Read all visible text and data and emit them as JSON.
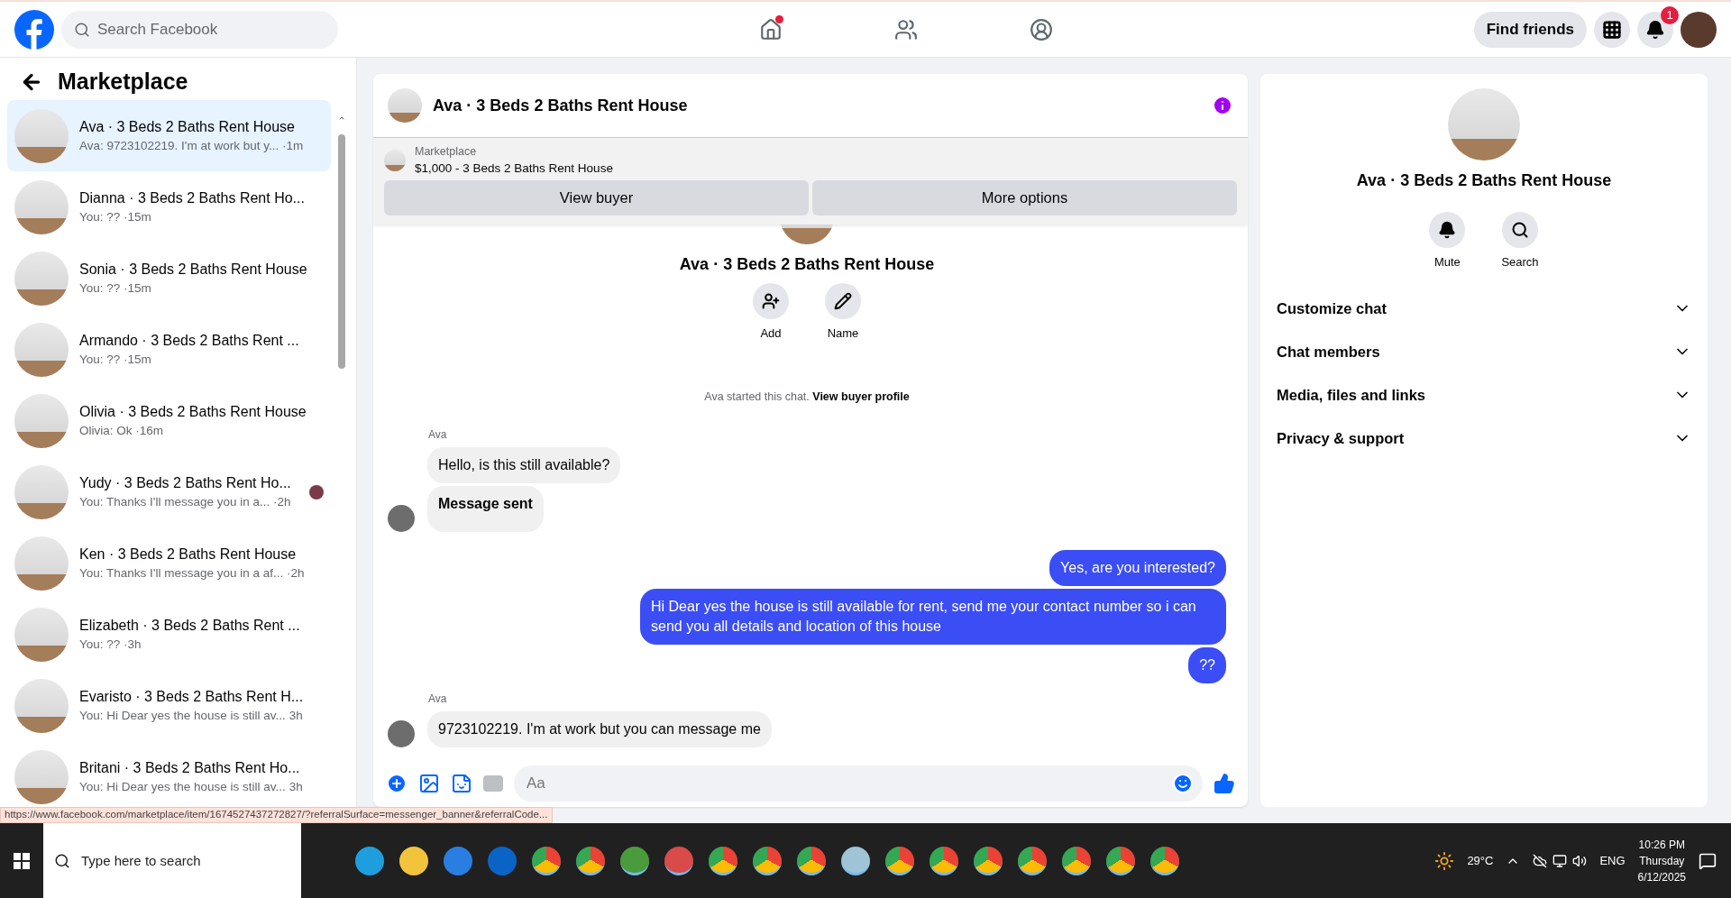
{
  "topbar": {
    "search": {
      "placeholder": "Search Facebook"
    },
    "nav": [
      {
        "selected": false,
        "dot": true
      },
      {
        "selected": false,
        "dot": false
      },
      {
        "selected": false,
        "dot": false
      }
    ],
    "find_friends": "Find friends",
    "notification_count": "1"
  },
  "sidebar": {
    "title": "Marketplace",
    "conversations": [
      {
        "name": "Ava · 3 Beds 2 Baths Rent House",
        "preview": "Ava: 9723102219. I'm at work but y...",
        "time": "·1m",
        "selected": true,
        "seen": false
      },
      {
        "name": "Dianna · 3 Beds 2 Baths Rent Ho...",
        "preview": "You: ??",
        "time": "·15m",
        "selected": false,
        "seen": false
      },
      {
        "name": "Sonia · 3 Beds 2 Baths Rent House",
        "preview": "You: ??",
        "time": "·15m",
        "selected": false,
        "seen": false
      },
      {
        "name": "Armando · 3 Beds 2 Baths Rent ...",
        "preview": "You: ??",
        "time": "·15m",
        "selected": false,
        "seen": false
      },
      {
        "name": "Olivia · 3 Beds 2 Baths Rent House",
        "preview": "Olivia: Ok",
        "time": "·16m",
        "selected": false,
        "seen": false
      },
      {
        "name": "Yudy · 3 Beds 2 Baths Rent Ho...",
        "preview": "You: Thanks I'll message you in a...",
        "time": "·2h",
        "selected": false,
        "seen": true
      },
      {
        "name": "Ken · 3 Beds 2 Baths Rent House",
        "preview": "You: Thanks I'll message you in a af...",
        "time": "·2h",
        "selected": false,
        "seen": false
      },
      {
        "name": "Elizabeth · 3 Beds 2 Baths Rent ...",
        "preview": "You: ??",
        "time": "·3h",
        "selected": false,
        "seen": false
      },
      {
        "name": "Evaristo · 3 Beds 2 Baths Rent H...",
        "preview": "You: Hi Dear yes the house is still av...",
        "time": "3h",
        "selected": false,
        "seen": false
      },
      {
        "name": "Britani · 3 Beds 2 Baths Rent Ho...",
        "preview": "You: Hi Dear yes the house is still av...",
        "time": "3h",
        "selected": false,
        "seen": false
      }
    ]
  },
  "status_url": "https://www.facebook.com/marketplace/item/1674527437272827/?referralSurface=messenger_banner&referralCode...",
  "chat": {
    "title": "Ava · 3 Beds 2 Baths Rent House",
    "listing": {
      "source": "Marketplace",
      "item": "$1,000 - 3 Beds 2 Baths Rent House"
    },
    "buttons": [
      "View buyer",
      "More options"
    ],
    "intro": {
      "title": "Ava · 3 Beds 2 Baths Rent House",
      "actions": [
        {
          "label": "Add"
        },
        {
          "label": "Name"
        }
      ],
      "note": "Ava started this chat.",
      "link": "View buyer profile"
    },
    "messages": [
      {
        "kind": "sender",
        "text": "Ava"
      },
      {
        "kind": "incoming",
        "text": "Hello, is this still available?",
        "bold": false,
        "avatar": false
      },
      {
        "kind": "incoming",
        "text": "Message sent",
        "bold": true,
        "avatar": true
      },
      {
        "kind": "outgoing",
        "text": "Yes, are you interested?",
        "bold": false
      },
      {
        "kind": "outgoing",
        "text": "Hi Dear yes the house is still available for rent, send me your contact number so i can send you all details and location of this house",
        "bold": false
      },
      {
        "kind": "outgoing",
        "text": "??",
        "bold": false
      },
      {
        "kind": "sender",
        "text": "Ava"
      },
      {
        "kind": "incoming",
        "text": "9723102219. I'm at work but you can message me",
        "bold": false,
        "avatar": true
      }
    ],
    "composer": {
      "placeholder": "Aa"
    }
  },
  "details": {
    "title": "Ava · 3 Beds 2 Baths Rent House",
    "actions": [
      {
        "label": "Mute"
      },
      {
        "label": "Search"
      }
    ],
    "sections": [
      {
        "label": "Customize chat",
        "expanded": false
      },
      {
        "label": "Chat members",
        "expanded": false
      },
      {
        "label": "Media, files and links",
        "expanded": false
      },
      {
        "label": "Privacy & support",
        "expanded": false
      }
    ]
  },
  "taskbar": {
    "search": {
      "placeholder": "Type here to search"
    },
    "weather": "29°C",
    "language": "ENG",
    "time": "10:26 PM",
    "day": "Thursday",
    "date": "6/12/2025"
  }
}
